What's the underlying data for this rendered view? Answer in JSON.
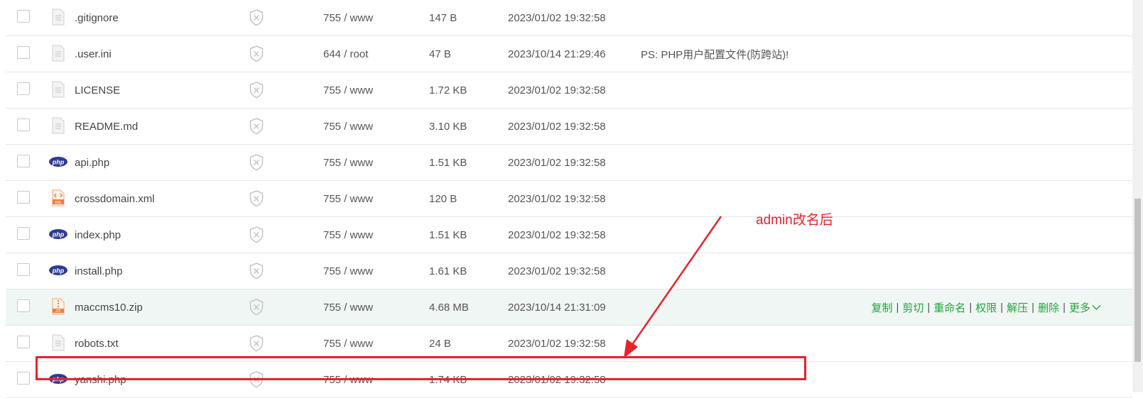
{
  "files": [
    {
      "name": ".gitignore",
      "icon": "document-icon",
      "perm": "755 / www",
      "size": "147 B",
      "time": "2023/01/02 19:32:58",
      "note": ""
    },
    {
      "name": ".user.ini",
      "icon": "document-icon",
      "perm": "644 / root",
      "size": "47 B",
      "time": "2023/10/14 21:29:46",
      "note": "PS: PHP用户配置文件(防跨站)!"
    },
    {
      "name": "LICENSE",
      "icon": "document-icon",
      "perm": "755 / www",
      "size": "1.72 KB",
      "time": "2023/01/02 19:32:58",
      "note": ""
    },
    {
      "name": "README.md",
      "icon": "document-icon",
      "perm": "755 / www",
      "size": "3.10 KB",
      "time": "2023/01/02 19:32:58",
      "note": ""
    },
    {
      "name": "api.php",
      "icon": "php-file-icon",
      "perm": "755 / www",
      "size": "1.51 KB",
      "time": "2023/01/02 19:32:58",
      "note": ""
    },
    {
      "name": "crossdomain.xml",
      "icon": "xml-file-icon",
      "perm": "755 / www",
      "size": "120 B",
      "time": "2023/01/02 19:32:58",
      "note": ""
    },
    {
      "name": "index.php",
      "icon": "php-file-icon",
      "perm": "755 / www",
      "size": "1.51 KB",
      "time": "2023/01/02 19:32:58",
      "note": ""
    },
    {
      "name": "install.php",
      "icon": "php-file-icon",
      "perm": "755 / www",
      "size": "1.61 KB",
      "time": "2023/01/02 19:32:58",
      "note": ""
    },
    {
      "name": "maccms10.zip",
      "icon": "zip-file-icon",
      "perm": "755 / www",
      "size": "4.68 MB",
      "time": "2023/10/14 21:31:09",
      "note": "",
      "hover": true
    },
    {
      "name": "robots.txt",
      "icon": "document-icon",
      "perm": "755 / www",
      "size": "24 B",
      "time": "2023/01/02 19:32:58",
      "note": ""
    },
    {
      "name": "yanshi.php",
      "icon": "php-file-icon",
      "perm": "755 / www",
      "size": "1.74 KB",
      "time": "2023/01/02 19:32:58",
      "note": ""
    }
  ],
  "row_actions": {
    "copy": "复制",
    "cut": "剪切",
    "rename": "重命名",
    "permissions": "权限",
    "extract": "解压",
    "delete": "删除",
    "more": "更多",
    "separator": "|"
  },
  "annotation": {
    "text": "admin改名后",
    "color": "#e8222b"
  },
  "colors": {
    "accent": "#20a53a",
    "php_badge": "#2f3b8f",
    "annotation": "#e8222b",
    "zip": "#f07c3c"
  }
}
